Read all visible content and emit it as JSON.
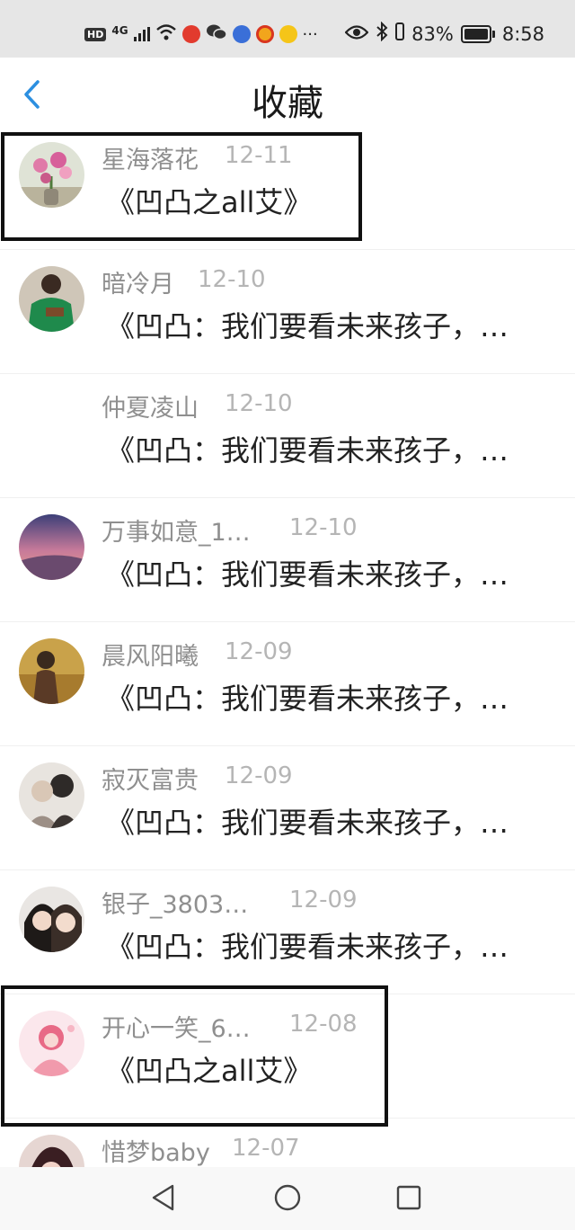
{
  "status_bar": {
    "hd": "HD",
    "network": "4G",
    "more": "···",
    "battery": "83%",
    "time": "8:58"
  },
  "header": {
    "title": "收藏"
  },
  "items": [
    {
      "name": "星海落花",
      "date": "12-11",
      "text": "《凹凸之all艾》"
    },
    {
      "name": "暗冷月",
      "date": "12-10",
      "text": "《凹凸：我们要看未来孩子，…"
    },
    {
      "name": "仲夏凌山",
      "date": "12-10",
      "text": "《凹凸：我们要看未来孩子，…"
    },
    {
      "name": "万事如意_1…",
      "date": "12-10",
      "text": "《凹凸：我们要看未来孩子，…"
    },
    {
      "name": "晨风阳曦",
      "date": "12-09",
      "text": "《凹凸：我们要看未来孩子，…"
    },
    {
      "name": "寂灭富贵",
      "date": "12-09",
      "text": "《凹凸：我们要看未来孩子，…"
    },
    {
      "name": "银子_3803…",
      "date": "12-09",
      "text": "《凹凸：我们要看未来孩子，…"
    },
    {
      "name": "开心一笑_6…",
      "date": "12-08",
      "text": "《凹凸之all艾》"
    },
    {
      "name": "惜梦baby",
      "date": "12-07",
      "text": ""
    }
  ],
  "colors": {
    "accent": "#2c8fe0",
    "name_gray": "#8f8f8f",
    "date_gray": "#b5b5b5",
    "text": "#222222"
  }
}
